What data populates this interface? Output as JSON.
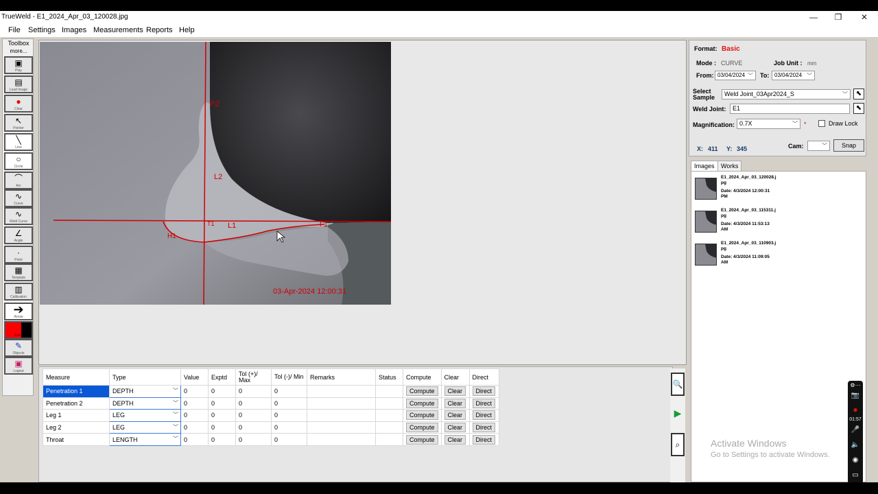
{
  "window": {
    "title": "TrueWeld  - E1_2024_Apr_03_120028.jpg",
    "controls": [
      "—",
      "❐",
      "✕"
    ]
  },
  "menu": [
    "File",
    "Settings",
    "Images",
    "Measurements",
    "Reports",
    "Help"
  ],
  "toolbox": {
    "title": "Toolbox",
    "more": "more...",
    "tools": [
      {
        "label": "Play",
        "icon": "play-icon"
      },
      {
        "label": "Load Image",
        "icon": "load-image-icon"
      },
      {
        "label": "Clear",
        "icon": "clear-icon"
      },
      {
        "label": "Pointer",
        "icon": "pointer-icon"
      },
      {
        "label": "Line",
        "icon": "line-icon"
      },
      {
        "label": "Circle",
        "icon": "circle-icon"
      },
      {
        "label": "Arc",
        "icon": "arc-icon"
      },
      {
        "label": "Curve",
        "icon": "curve-icon"
      },
      {
        "label": "Weld Curve",
        "icon": "weld-curve-icon"
      },
      {
        "label": "Angle",
        "icon": "angle-icon"
      },
      {
        "label": "Point",
        "icon": "point-icon"
      },
      {
        "label": "Template",
        "icon": "template-icon"
      },
      {
        "label": "Calibration",
        "icon": "calibration-icon"
      },
      {
        "label": "Arrow",
        "icon": "arrow-icon"
      },
      {
        "label": "Color",
        "icon": "color-icon"
      },
      {
        "label": "Objects",
        "icon": "objects-icon"
      },
      {
        "label": "Logout",
        "icon": "logout-icon"
      }
    ]
  },
  "image": {
    "labels": {
      "p2": "P2",
      "l2": "L2",
      "l1": "L1",
      "t1": "T1",
      "h1": "H1",
      "f1": "F1"
    },
    "timestamp": "03-Apr-2024 12:00:31"
  },
  "measurements": {
    "headers": [
      "Measure",
      "Type",
      "Value",
      "Exptd",
      "Tol (+)/ Max",
      "Tol (-)/ Min",
      "Remarks",
      "Status",
      "Compute",
      "Clear",
      "Direct"
    ],
    "rows": [
      {
        "measure": "Penetration 1",
        "type": "DEPTH",
        "value": "0",
        "exptd": "0",
        "tolmax": "0",
        "tolmin": "0",
        "remarks": "",
        "status": "",
        "compute": "Compute",
        "clear": "Clear",
        "direct": "Direct"
      },
      {
        "measure": "Penetration 2",
        "type": "DEPTH",
        "value": "0",
        "exptd": "0",
        "tolmax": "0",
        "tolmin": "0",
        "remarks": "",
        "status": "",
        "compute": "Compute",
        "clear": "Clear",
        "direct": "Direct"
      },
      {
        "measure": "Leg 1",
        "type": "LEG",
        "value": "0",
        "exptd": "0",
        "tolmax": "0",
        "tolmin": "0",
        "remarks": "",
        "status": "",
        "compute": "Compute",
        "clear": "Clear",
        "direct": "Direct"
      },
      {
        "measure": "Leg 2",
        "type": "LEG",
        "value": "0",
        "exptd": "0",
        "tolmax": "0",
        "tolmin": "0",
        "remarks": "",
        "status": "",
        "compute": "Compute",
        "clear": "Clear",
        "direct": "Direct"
      },
      {
        "measure": "Throat",
        "type": "LENGTH",
        "value": "0",
        "exptd": "0",
        "tolmax": "0",
        "tolmin": "0",
        "remarks": "",
        "status": "",
        "compute": "Compute",
        "clear": "Clear",
        "direct": "Direct"
      }
    ]
  },
  "settings": {
    "format_label": "Format:",
    "format_value": "Basic",
    "mode_label": "Mode :",
    "mode_value": "CURVE",
    "jobunit_label": "Job Unit :",
    "jobunit_value": "mm",
    "from_label": "From:",
    "from_value": "03/04/2024",
    "to_label": "To:",
    "to_value": "03/04/2024",
    "select_sample_label_1": "Select",
    "select_sample_label_2": "Sample",
    "sample_value": "Weld Joint_03Apr2024_S",
    "weld_joint_label": "Weld Joint:",
    "weld_joint_value": "E1",
    "magnification_label": "Magnification:",
    "magnification_value": "0.7X",
    "draw_lock_label": "Draw Lock",
    "x_label": "X:",
    "x_value": "411",
    "y_label": "Y:",
    "y_value": "345",
    "cam_label": "Cam:",
    "snap_label": "Snap"
  },
  "tabs": [
    "Images",
    "Works"
  ],
  "images": [
    {
      "name_1": "E1_2024_Apr_03_120028.j",
      "name_2": "pg",
      "date_1": "Date: 4/3/2024 12:00:31",
      "date_2": "PM"
    },
    {
      "name_1": "E1_2024_Apr_03_115311.j",
      "name_2": "pg",
      "date_1": "Date: 4/3/2024 11:53:13",
      "date_2": "AM"
    },
    {
      "name_1": "E1_2024_Apr_03_110903.j",
      "name_2": "pg",
      "date_1": "Date: 4/3/2024 11:09:05",
      "date_2": "AM"
    }
  ],
  "watermark": {
    "line1": "Activate Windows",
    "line2": "Go to Settings to activate Windows."
  },
  "recorder": {
    "time": "01:57"
  },
  "colors": {
    "accent_red": "#e01010",
    "selection_blue": "#0a58d6",
    "overlay_red": "#d00000"
  }
}
